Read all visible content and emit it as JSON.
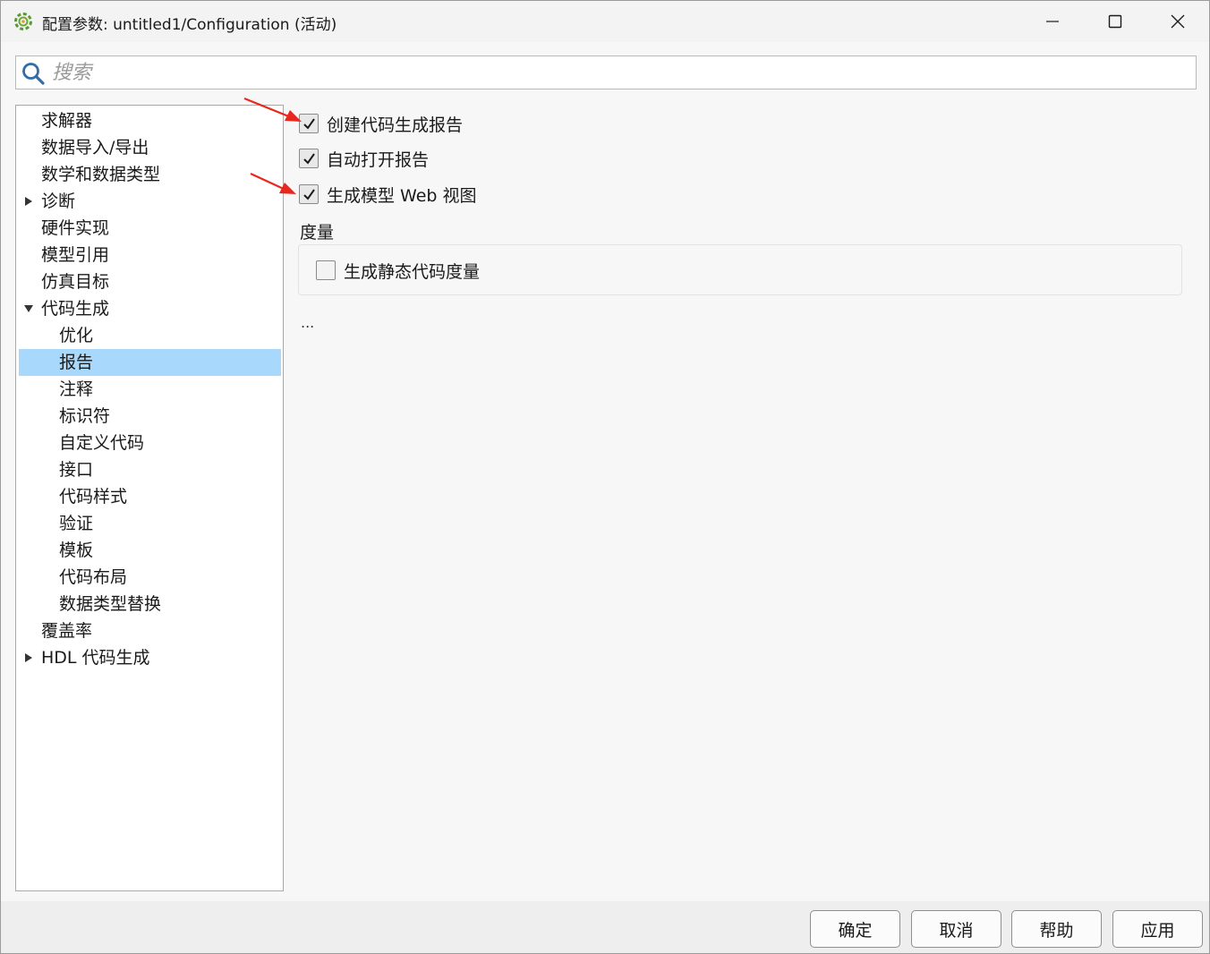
{
  "window": {
    "title": "配置参数: untitled1/Configuration (活动)"
  },
  "search": {
    "placeholder": "搜索",
    "value": ""
  },
  "tree": {
    "items": [
      {
        "label": "求解器",
        "level": 0,
        "expander": "none",
        "selected": false
      },
      {
        "label": "数据导入/导出",
        "level": 0,
        "expander": "none",
        "selected": false
      },
      {
        "label": "数学和数据类型",
        "level": 0,
        "expander": "none",
        "selected": false
      },
      {
        "label": "诊断",
        "level": 0,
        "expander": "collapsed",
        "selected": false
      },
      {
        "label": "硬件实现",
        "level": 0,
        "expander": "none",
        "selected": false
      },
      {
        "label": "模型引用",
        "level": 0,
        "expander": "none",
        "selected": false
      },
      {
        "label": "仿真目标",
        "level": 0,
        "expander": "none",
        "selected": false
      },
      {
        "label": "代码生成",
        "level": 0,
        "expander": "expanded",
        "selected": false
      },
      {
        "label": "优化",
        "level": 1,
        "expander": "none",
        "selected": false
      },
      {
        "label": "报告",
        "level": 1,
        "expander": "none",
        "selected": true
      },
      {
        "label": "注释",
        "level": 1,
        "expander": "none",
        "selected": false
      },
      {
        "label": "标识符",
        "level": 1,
        "expander": "none",
        "selected": false
      },
      {
        "label": "自定义代码",
        "level": 1,
        "expander": "none",
        "selected": false
      },
      {
        "label": "接口",
        "level": 1,
        "expander": "none",
        "selected": false
      },
      {
        "label": "代码样式",
        "level": 1,
        "expander": "none",
        "selected": false
      },
      {
        "label": "验证",
        "level": 1,
        "expander": "none",
        "selected": false
      },
      {
        "label": "模板",
        "level": 1,
        "expander": "none",
        "selected": false
      },
      {
        "label": "代码布局",
        "level": 1,
        "expander": "none",
        "selected": false
      },
      {
        "label": "数据类型替换",
        "level": 1,
        "expander": "none",
        "selected": false
      },
      {
        "label": "覆盖率",
        "level": 0,
        "expander": "none",
        "selected": false
      },
      {
        "label": "HDL 代码生成",
        "level": 0,
        "expander": "collapsed",
        "selected": false
      }
    ]
  },
  "report": {
    "create_report": {
      "label": "创建代码生成报告",
      "checked": true
    },
    "open_report": {
      "label": "自动打开报告",
      "checked": true
    },
    "web_view": {
      "label": "生成模型 Web 视图",
      "checked": true
    },
    "metrics": {
      "title": "度量",
      "static_metrics": {
        "label": "生成静态代码度量",
        "checked": false
      }
    },
    "more": "..."
  },
  "buttons": {
    "ok": "确定",
    "cancel": "取消",
    "help": "帮助",
    "apply": "应用"
  },
  "colors": {
    "selection": "#a8d8fb",
    "annotation_arrow": "#e8281e",
    "app_icon": "#5a9a2e"
  },
  "icons": {
    "app": "simulink-config-icon",
    "search": "search-icon",
    "minimize": "minimize-icon",
    "maximize": "maximize-icon",
    "close": "close-icon",
    "checkmark": "checkmark-icon",
    "expand": "triangle-right-icon",
    "collapse": "triangle-down-icon"
  }
}
